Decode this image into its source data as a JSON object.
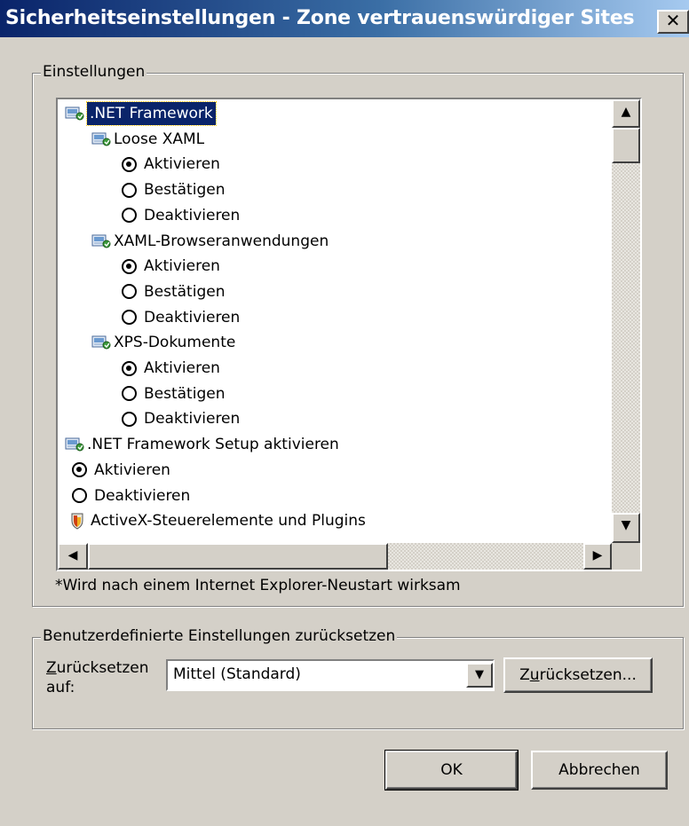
{
  "window": {
    "title": "Sicherheitseinstellungen - Zone vertrauenswürdiger Sites",
    "close_label": "✕"
  },
  "settings_group": {
    "legend": "Einstellungen",
    "note": "*Wird nach einem Internet Explorer-Neustart wirksam",
    "tree": [
      {
        "label": ".NET Framework",
        "kind": "node",
        "icon": "net-setting-icon",
        "selected": true
      },
      {
        "label": "Loose XAML",
        "kind": "node",
        "icon": "net-setting-icon"
      },
      {
        "label": "Aktivieren",
        "kind": "radio",
        "checked": true
      },
      {
        "label": "Bestätigen",
        "kind": "radio",
        "checked": false
      },
      {
        "label": "Deaktivieren",
        "kind": "radio",
        "checked": false
      },
      {
        "label": "XAML-Browseranwendungen",
        "kind": "node",
        "icon": "net-setting-icon"
      },
      {
        "label": "Aktivieren",
        "kind": "radio",
        "checked": true
      },
      {
        "label": "Bestätigen",
        "kind": "radio",
        "checked": false
      },
      {
        "label": "Deaktivieren",
        "kind": "radio",
        "checked": false
      },
      {
        "label": "XPS-Dokumente",
        "kind": "node",
        "icon": "net-setting-icon"
      },
      {
        "label": "Aktivieren",
        "kind": "radio",
        "checked": true
      },
      {
        "label": "Bestätigen",
        "kind": "radio",
        "checked": false
      },
      {
        "label": "Deaktivieren",
        "kind": "radio",
        "checked": false
      },
      {
        "label": ".NET Framework Setup aktivieren",
        "kind": "node",
        "icon": "net-setting-icon"
      },
      {
        "label": "Aktivieren",
        "kind": "radio",
        "checked": true
      },
      {
        "label": "Deaktivieren",
        "kind": "radio",
        "checked": false
      },
      {
        "label": "ActiveX-Steuerelemente und Plugins",
        "kind": "node",
        "icon": "activex-shield-icon"
      }
    ]
  },
  "reset_group": {
    "legend": "Benutzerdefinierte Einstellungen zurücksetzen",
    "reset_to_label_underlined": "Z",
    "reset_to_label_rest": "urücksetzen",
    "reset_to_label_line2": "auf:",
    "combo_value": "Mittel (Standard)",
    "reset_button_pre": "Z",
    "reset_button_underlined": "u",
    "reset_button_post": "rücksetzen..."
  },
  "buttons": {
    "ok": "OK",
    "cancel": "Abbrechen"
  },
  "colors": {
    "face": "#d4d0c8",
    "title_start": "#0a246a",
    "selection": "#0a246a"
  }
}
